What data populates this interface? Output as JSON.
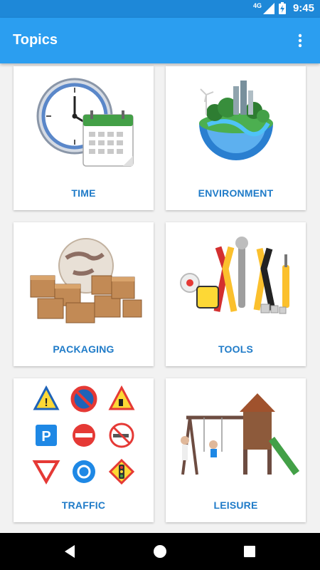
{
  "status_bar": {
    "network": "4G",
    "time": "9:45",
    "icons": [
      "signal-icon",
      "battery-charging-icon"
    ]
  },
  "app_bar": {
    "title": "Topics",
    "overflow_icon": "more-vert-icon"
  },
  "topics": [
    {
      "label": "TIME",
      "image": "clock-calendar"
    },
    {
      "label": "ENVIRONMENT",
      "image": "green-earth"
    },
    {
      "label": "PACKAGING",
      "image": "boxes-globe"
    },
    {
      "label": "TOOLS",
      "image": "hand-tools"
    },
    {
      "label": "TRAFFIC",
      "image": "traffic-signs"
    },
    {
      "label": "LEISURE",
      "image": "swing-set"
    }
  ],
  "nav_bar": {
    "buttons": [
      "back-icon",
      "home-icon",
      "recents-icon"
    ]
  },
  "colors": {
    "status_bar": "#1e88d8",
    "app_bar": "#2b9ef0",
    "label": "#1f7bc8"
  }
}
